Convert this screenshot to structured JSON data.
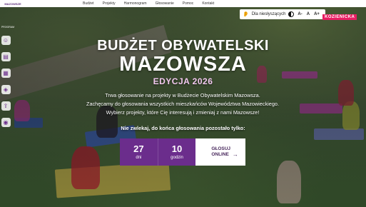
{
  "topbar": {
    "logo": "MAZOWSZE",
    "nav": [
      "Budżet",
      "Projekty",
      "Harmonogram",
      "Głosowanie",
      "Pomoc",
      "Kontakt"
    ]
  },
  "accessibility": {
    "label": "Dla niesłyszących",
    "font_minus": "A-",
    "font_normal": "A",
    "font_plus": "A+"
  },
  "corner_logo": {
    "line1": "KRONIKA",
    "line2": "KOZIENICKA"
  },
  "sidebar": {
    "label": "PROGRAM",
    "icons": [
      "person-icon",
      "document-icon",
      "calendar-icon",
      "map-icon",
      "share-icon",
      "user-circle-icon"
    ]
  },
  "hero": {
    "title_line1": "BUDŻET OBYWATELSKI",
    "title_line2": "MAZOWSZA",
    "edition": "EDYCJA 2026",
    "description_lines": [
      "Trwa głosowanie na projekty w Budżecie Obywatelskim Mazowsza.",
      "Zachęcamy do głosowania wszystkich mieszkańców Województwa Mazowieckiego.",
      "Wybierz projekty, które Cię interesują i zmieniaj z nami Mazowsze!"
    ],
    "countdown_label": "Nie zwlekaj, do końca głosowania pozostało tylko:"
  },
  "countdown": {
    "days_value": "27",
    "days_unit": "dni",
    "hours_value": "10",
    "hours_unit": "godzin"
  },
  "vote_button": {
    "line1": "GŁOSUJ",
    "line2": "ONLINE",
    "arrow": "→"
  },
  "colors": {
    "brand_purple": "#6b2d8c",
    "accent_pink": "#e91e63",
    "edition_pink": "#f2c8ef"
  }
}
